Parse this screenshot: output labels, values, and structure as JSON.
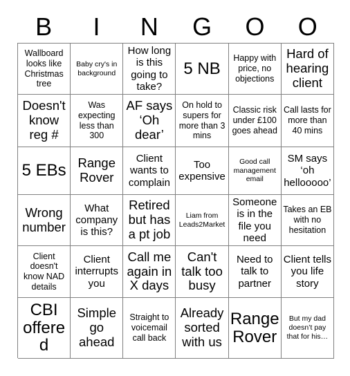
{
  "card": {
    "title": "BINGOO",
    "header_letters": [
      "B",
      "I",
      "N",
      "G",
      "O",
      "O"
    ],
    "columns": 6,
    "rows": 6,
    "grid_line_color": "#808080",
    "text_color": "#000000",
    "background_color": "#ffffff",
    "cells": [
      {
        "text": "Wallboard looks like Christmas tree",
        "size": "sm"
      },
      {
        "text": "Baby cry's in background",
        "size": "xs"
      },
      {
        "text": "How long is this going to take?",
        "size": "md"
      },
      {
        "text": "5 NB",
        "size": "xl"
      },
      {
        "text": "Happy with price, no objections",
        "size": "sm"
      },
      {
        "text": "Hard of hearing client",
        "size": "lg"
      },
      {
        "text": "Doesn't know reg #",
        "size": "lg"
      },
      {
        "text": "Was expecting less than 300",
        "size": "sm"
      },
      {
        "text": "AF says ‘Oh dear’",
        "size": "lg"
      },
      {
        "text": "On hold to supers for more than 3 mins",
        "size": "sm"
      },
      {
        "text": "Classic risk under £100 goes ahead",
        "size": "sm"
      },
      {
        "text": "Call lasts for more than 40 mins",
        "size": "sm"
      },
      {
        "text": "5 EBs",
        "size": "xl"
      },
      {
        "text": "Range Rover",
        "size": "lg"
      },
      {
        "text": "Client wants to complain",
        "size": "md"
      },
      {
        "text": "Too expensive",
        "size": "md"
      },
      {
        "text": "Good call management email",
        "size": "xs"
      },
      {
        "text": "SM says ‘oh hellooooo’",
        "size": "md"
      },
      {
        "text": "Wrong number",
        "size": "lg"
      },
      {
        "text": "What company is this?",
        "size": "md"
      },
      {
        "text": "Retired but has a pt job",
        "size": "lg"
      },
      {
        "text": "Liam from Leads2Market",
        "size": "xs"
      },
      {
        "text": "Someone is in the file you need",
        "size": "md"
      },
      {
        "text": "Takes an EB with no hesitation",
        "size": "sm"
      },
      {
        "text": "Client doesn't know NAD details",
        "size": "sm"
      },
      {
        "text": "Client interrupts you",
        "size": "md"
      },
      {
        "text": "Call me again in X days",
        "size": "lg"
      },
      {
        "text": "Can't talk too busy",
        "size": "lg"
      },
      {
        "text": "Need to talk to partner",
        "size": "md"
      },
      {
        "text": "Client tells you life story",
        "size": "md"
      },
      {
        "text": "CBI offered",
        "size": "xl"
      },
      {
        "text": "Simple go ahead",
        "size": "lg"
      },
      {
        "text": "Straight to voicemail call back",
        "size": "sm"
      },
      {
        "text": "Already sorted with us",
        "size": "lg"
      },
      {
        "text": "Range Rover",
        "size": "xl"
      },
      {
        "text": "But my dad doesn’t pay that for his…",
        "size": "xs"
      }
    ]
  }
}
